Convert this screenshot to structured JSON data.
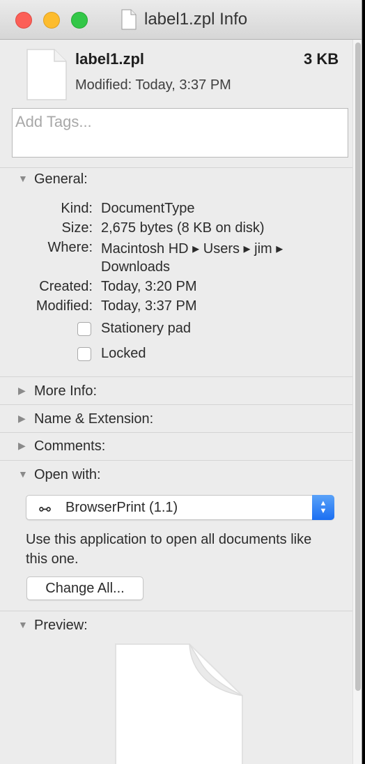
{
  "window": {
    "title": "label1.zpl Info"
  },
  "header": {
    "name": "label1.zpl",
    "size": "3 KB",
    "modified": "Modified: Today, 3:37 PM",
    "icon": "document-icon"
  },
  "tags": {
    "placeholder": "Add Tags..."
  },
  "general": {
    "label": "General:",
    "expanded": true,
    "rows": [
      {
        "label": "Kind:",
        "value": "DocumentType"
      },
      {
        "label": "Size:",
        "value": "2,675 bytes (8 KB on disk)"
      },
      {
        "label": "Where:",
        "value": "Macintosh HD ▸ Users ▸ jim ▸"
      },
      {
        "label": "",
        "value": "Downloads"
      },
      {
        "label": "Created:",
        "value": "Today, 3:20 PM"
      },
      {
        "label": "Modified:",
        "value": "Today, 3:37 PM"
      }
    ],
    "checkboxes": [
      {
        "label": "Stationery pad",
        "checked": false
      },
      {
        "label": "Locked",
        "checked": false
      }
    ]
  },
  "sections": {
    "more_info": "More Info:",
    "name_ext": "Name & Extension:",
    "comments": "Comments:",
    "open_with": "Open with:",
    "preview": "Preview:"
  },
  "open_with": {
    "app_icon": "⧟",
    "app": "BrowserPrint (1.1)",
    "description": "Use this application to open all documents like this one.",
    "change_all": "Change All..."
  },
  "colors": {
    "close": "#fc5f57",
    "minimize": "#fdbc2e",
    "zoom": "#33c748",
    "accent": "#1b6ff2"
  }
}
